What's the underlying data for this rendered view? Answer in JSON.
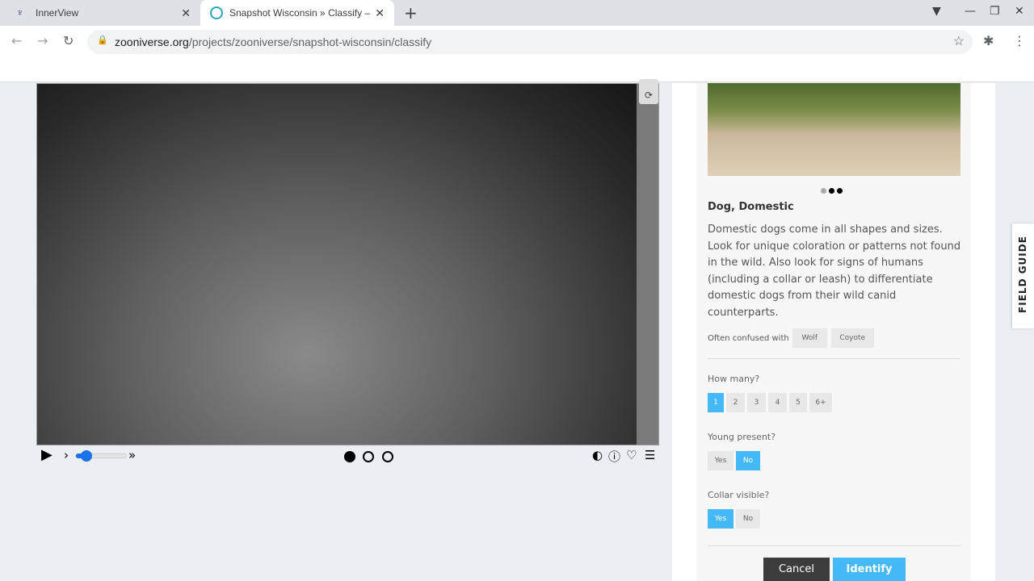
{
  "browser": {
    "tabs": [
      {
        "title": "InnerView",
        "favicon": "innerview-logo"
      },
      {
        "title": "Snapshot Wisconsin » Classify –",
        "favicon": "zooniverse-logo"
      }
    ],
    "url_domain": "zooniverse.org",
    "url_path": "/projects/zooniverse/snapshot-wisconsin/classify"
  },
  "viewer": {
    "frame_count": 3,
    "current_frame": 1,
    "playback_speed_fraction": 0.2
  },
  "field_guide_panel": {
    "example_images": 3,
    "current_example": 2,
    "species": "Dog, Domestic",
    "description": "Domestic dogs come in all shapes and sizes. Look for unique coloration or patterns not found in the wild. Also look for signs of humans (including a collar or leash) to differentiate domestic dogs from their wild canid counterparts.",
    "confused_label": "Often confused with",
    "confused": [
      "Wolf",
      "Coyote"
    ],
    "how_many": {
      "label": "How many?",
      "options": [
        "1",
        "2",
        "3",
        "4",
        "5",
        "6+"
      ],
      "selected": "1"
    },
    "young": {
      "label": "Young present?",
      "options": [
        "Yes",
        "No"
      ],
      "selected": "No"
    },
    "collar": {
      "label": "Collar visible?",
      "options": [
        "Yes",
        "No"
      ],
      "selected": "Yes"
    },
    "cancel": "Cancel",
    "identify": "Identify"
  },
  "field_guide_tab": "FIELD GUIDE",
  "colors": {
    "accent": "#45b8f7",
    "cancel": "#3c3c3c"
  }
}
